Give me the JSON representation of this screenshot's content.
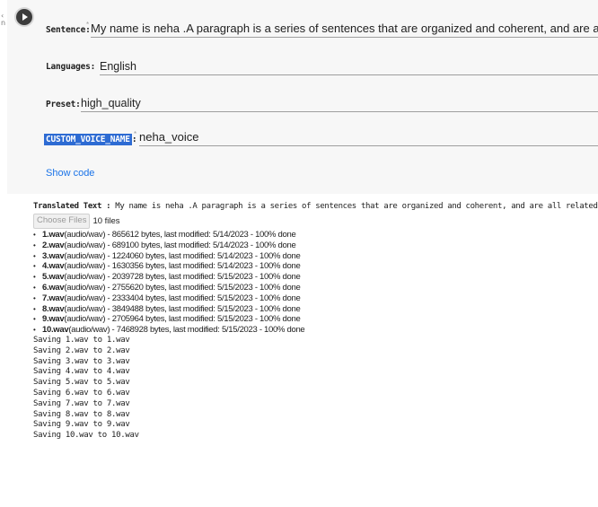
{
  "form": {
    "sentence": {
      "label": "Sentence:",
      "value": "My name is neha .A paragraph is a series of sentences that are organized and coherent, and are all related to a single topic."
    },
    "languages": {
      "label": "Languages:",
      "value": "English"
    },
    "preset": {
      "label": "Preset:",
      "value": "high_quality"
    },
    "custom_voice": {
      "label": "CUSTOM_VOICE_NAME",
      "suffix": ":",
      "value": "neha_voice"
    },
    "required_marker": "*",
    "show_code_label": "Show code"
  },
  "output": {
    "translated_label": "Translated Text :",
    "translated_value": "My name is neha .A paragraph is a series of sentences that are organized and coherent, and are all related to a single topi",
    "choose_files_label": "Choose Files",
    "files_count": "10 files",
    "files": [
      {
        "name": "1.wav",
        "info": "(audio/wav) - 865612 bytes, last modified: 5/14/2023 - 100% done"
      },
      {
        "name": "2.wav",
        "info": "(audio/wav) - 689100 bytes, last modified: 5/14/2023 - 100% done"
      },
      {
        "name": "3.wav",
        "info": "(audio/wav) - 1224060 bytes, last modified: 5/14/2023 - 100% done"
      },
      {
        "name": "4.wav",
        "info": "(audio/wav) - 1630356 bytes, last modified: 5/14/2023 - 100% done"
      },
      {
        "name": "5.wav",
        "info": "(audio/wav) - 2039728 bytes, last modified: 5/15/2023 - 100% done"
      },
      {
        "name": "6.wav",
        "info": "(audio/wav) - 2755620 bytes, last modified: 5/15/2023 - 100% done"
      },
      {
        "name": "7.wav",
        "info": "(audio/wav) - 2333404 bytes, last modified: 5/15/2023 - 100% done"
      },
      {
        "name": "8.wav",
        "info": "(audio/wav) - 3849488 bytes, last modified: 5/15/2023 - 100% done"
      },
      {
        "name": "9.wav",
        "info": "(audio/wav) - 2705964 bytes, last modified: 5/15/2023 - 100% done"
      },
      {
        "name": "10.wav",
        "info": "(audio/wav) - 7468928 bytes, last modified: 5/15/2023 - 100% done"
      }
    ],
    "saving_lines": [
      "Saving 1.wav to 1.wav",
      "Saving 2.wav to 2.wav",
      "Saving 3.wav to 3.wav",
      "Saving 4.wav to 4.wav",
      "Saving 5.wav to 5.wav",
      "Saving 6.wav to 6.wav",
      "Saving 7.wav to 7.wav",
      "Saving 8.wav to 8.wav",
      "Saving 9.wav to 9.wav",
      "Saving 10.wav to 10.wav"
    ]
  },
  "icons": {
    "run": "play-icon"
  },
  "colors": {
    "accent": "#1a73e8",
    "highlight": "#2d6bd3",
    "cell_bg": "#f7f7f7"
  }
}
